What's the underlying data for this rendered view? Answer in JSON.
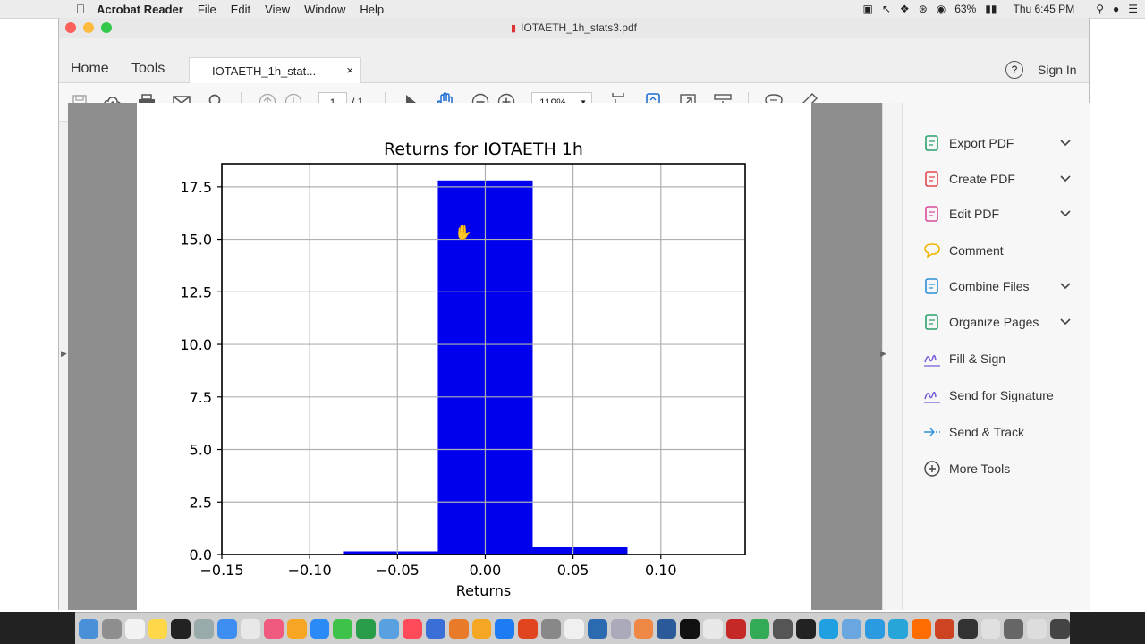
{
  "menubar": {
    "app_name": "Acrobat Reader",
    "menus": [
      "File",
      "Edit",
      "View",
      "Window",
      "Help"
    ],
    "battery": "63%",
    "clock": "Thu 6:45 PM"
  },
  "window": {
    "title": "IOTAETH_1h_stats3.pdf"
  },
  "tabs": {
    "home": "Home",
    "tools": "Tools",
    "document_tab": "IOTAETH_1h_stat...",
    "help": "?",
    "sign_in": "Sign In"
  },
  "toolbar": {
    "page_current": "1",
    "page_total": "/ 1",
    "zoom": "119%"
  },
  "tools_panel": {
    "items": [
      {
        "label": "Export PDF",
        "icon": "export-pdf-icon",
        "color": "#2aa06a",
        "chevron": true
      },
      {
        "label": "Create PDF",
        "icon": "create-pdf-icon",
        "color": "#e0464b",
        "chevron": true
      },
      {
        "label": "Edit PDF",
        "icon": "edit-pdf-icon",
        "color": "#d94b9b",
        "chevron": true
      },
      {
        "label": "Comment",
        "icon": "comment-icon",
        "color": "#f0b400",
        "chevron": false
      },
      {
        "label": "Combine Files",
        "icon": "combine-files-icon",
        "color": "#2b8fd6",
        "chevron": true
      },
      {
        "label": "Organize Pages",
        "icon": "organize-pages-icon",
        "color": "#2aa06a",
        "chevron": true
      },
      {
        "label": "Fill & Sign",
        "icon": "fill-sign-icon",
        "color": "#7a5bd6",
        "chevron": false
      },
      {
        "label": "Send for Signature",
        "icon": "send-signature-icon",
        "color": "#7a5bd6",
        "chevron": false
      },
      {
        "label": "Send & Track",
        "icon": "send-track-icon",
        "color": "#2b8fd6",
        "chevron": false
      },
      {
        "label": "More Tools",
        "icon": "more-tools-icon",
        "color": "#444444",
        "chevron": false
      }
    ]
  },
  "chart_data": {
    "type": "bar",
    "title": "Returns for IOTAETH 1h",
    "xlabel": "Returns",
    "ylabel": "",
    "bins": [
      {
        "x0": -0.081,
        "x1": -0.027,
        "value": 0.15
      },
      {
        "x0": -0.027,
        "x1": 0.027,
        "value": 17.8
      },
      {
        "x0": 0.027,
        "x1": 0.081,
        "value": 0.35
      },
      {
        "x0": 0.081,
        "x1": 0.135,
        "value": 0.02
      }
    ],
    "xlim": [
      -0.15,
      0.148
    ],
    "ylim": [
      0,
      18.6
    ],
    "xticks": [
      -0.15,
      -0.1,
      -0.05,
      0.0,
      0.05,
      0.1
    ],
    "xtick_labels": [
      "−0.15",
      "−0.10",
      "−0.05",
      "0.00",
      "0.05",
      "0.10"
    ],
    "yticks": [
      0.0,
      2.5,
      5.0,
      7.5,
      10.0,
      12.5,
      15.0,
      17.5
    ],
    "ytick_labels": [
      "0.0",
      "2.5",
      "5.0",
      "7.5",
      "10.0",
      "12.5",
      "15.0",
      "17.5"
    ],
    "grid": true,
    "bar_color": "#0000ee"
  }
}
